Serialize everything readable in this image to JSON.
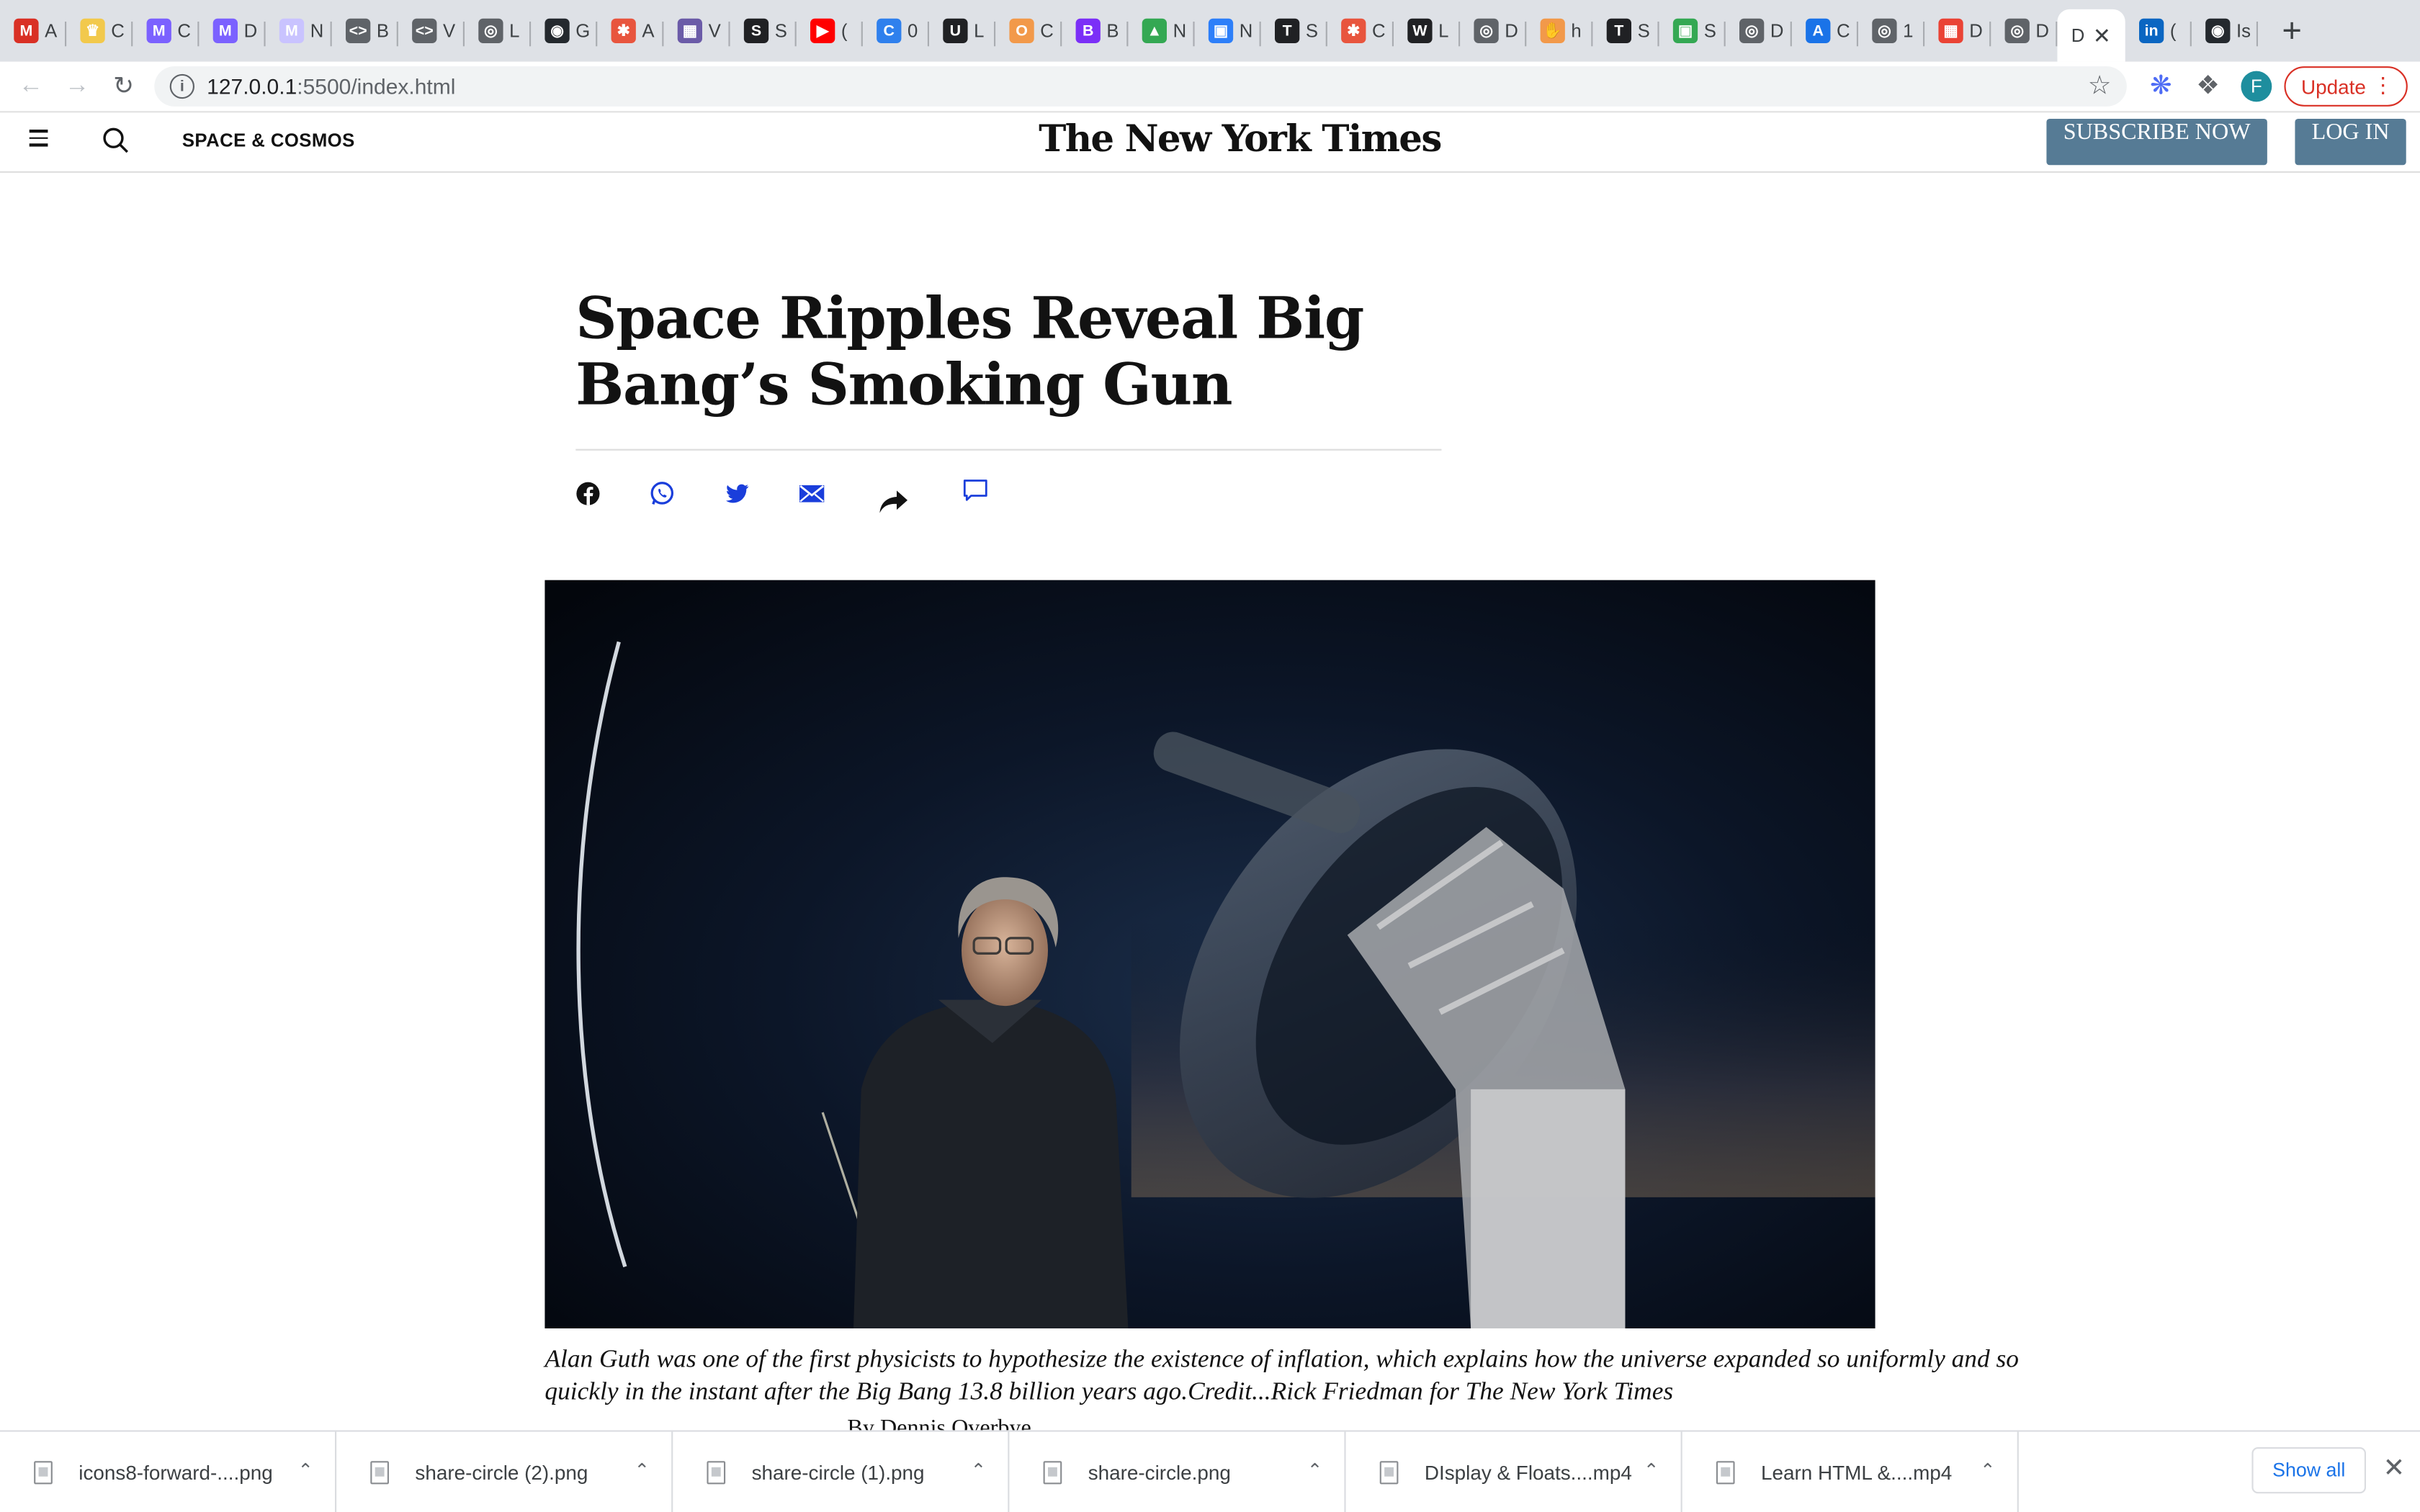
{
  "browser": {
    "tabs": [
      {
        "letter": "M",
        "title": "A",
        "color": "#d93025"
      },
      {
        "letter": "♛",
        "title": "C",
        "color": "#f2c94c"
      },
      {
        "letter": "M",
        "title": "C",
        "color": "#7b61ff"
      },
      {
        "letter": "M",
        "title": "D",
        "color": "#7b61ff"
      },
      {
        "letter": "M",
        "title": "N",
        "color": "#c9c3ff"
      },
      {
        "letter": "<>",
        "title": "B",
        "color": "#5f6368"
      },
      {
        "letter": "<>",
        "title": "V",
        "color": "#5f6368"
      },
      {
        "letter": "◎",
        "title": "L",
        "color": "#5f6368"
      },
      {
        "letter": "◉",
        "title": "G",
        "color": "#24292e"
      },
      {
        "letter": "✱",
        "title": "A",
        "color": "#e8553e"
      },
      {
        "letter": "▦",
        "title": "V",
        "color": "#6b5ba8"
      },
      {
        "letter": "S",
        "title": "S",
        "color": "#202124"
      },
      {
        "letter": "▶",
        "title": "(",
        "color": "#ff0000"
      },
      {
        "letter": "C",
        "title": "0",
        "color": "#2f80ed"
      },
      {
        "letter": "U",
        "title": "L",
        "color": "#202124"
      },
      {
        "letter": "O",
        "title": "C",
        "color": "#f2994a"
      },
      {
        "letter": "B",
        "title": "B",
        "color": "#7b2ff7"
      },
      {
        "letter": "▲",
        "title": "N",
        "color": "#34a853"
      },
      {
        "letter": "▣",
        "title": "N",
        "color": "#2d7ff9"
      },
      {
        "letter": "T",
        "title": "S",
        "color": "#202124"
      },
      {
        "letter": "✱",
        "title": "C",
        "color": "#e8553e"
      },
      {
        "letter": "W",
        "title": "L",
        "color": "#202124"
      },
      {
        "letter": "◎",
        "title": "D",
        "color": "#5f6368"
      },
      {
        "letter": "✋",
        "title": "h",
        "color": "#f2994a"
      },
      {
        "letter": "T",
        "title": "S",
        "color": "#202124"
      },
      {
        "letter": "▣",
        "title": "S",
        "color": "#34a853"
      },
      {
        "letter": "◎",
        "title": "D",
        "color": "#5f6368"
      },
      {
        "letter": "A",
        "title": "C",
        "color": "#1a73e8"
      },
      {
        "letter": "◎",
        "title": "1",
        "color": "#5f6368"
      },
      {
        "letter": "▦",
        "title": "D",
        "color": "#ea4335"
      },
      {
        "letter": "◎",
        "title": "D",
        "color": "#5f6368"
      },
      {
        "letter": "",
        "title": "D",
        "color": "#5f6368",
        "active": true
      },
      {
        "letter": "in",
        "title": "(",
        "color": "#0a66c2"
      },
      {
        "letter": "◉",
        "title": "Is",
        "color": "#24292e"
      }
    ],
    "new_tab_label": "+",
    "url_host": "127.0.0.1",
    "url_rest": ":5500/index.html",
    "avatar_letter": "F",
    "update_label": "Update"
  },
  "masthead": {
    "section": "SPACE & COSMOS",
    "logo": "The New York Times",
    "subscribe_label": "SUBSCRIBE NOW",
    "login_label": "LOG IN"
  },
  "article": {
    "headline": "Space Ripples Reveal Big Bang’s Smoking Gun",
    "share_icons": [
      "facebook-icon",
      "whatsapp-icon",
      "twitter-icon",
      "email-icon",
      "share-icon",
      "comment-icon"
    ],
    "caption": "Alan Guth was one of the first physicists to hypothesize the existence of inflation, which explains how the universe expanded so uniformly and so quickly in the instant after the Big Bang 13.8 billion years ago.Credit...Rick Friedman for The New York Times",
    "byline": "By Dennis Overbye"
  },
  "downloads": {
    "items": [
      {
        "name": "icons8-forward-....png"
      },
      {
        "name": "share-circle (2).png"
      },
      {
        "name": "share-circle (1).png"
      },
      {
        "name": "share-circle.png"
      },
      {
        "name": "DIsplay & Floats....mp4"
      },
      {
        "name": "Learn HTML &....mp4"
      }
    ],
    "show_all_label": "Show all"
  },
  "colors": {
    "accent_button": "#567b95",
    "share_icon_blue": "#1a3edb",
    "update_red": "#d93025"
  }
}
